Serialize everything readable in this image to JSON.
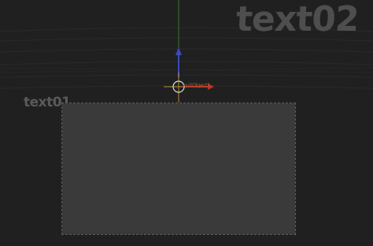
{
  "scene": {
    "big_text_object": "text02",
    "small_text_object": "text01",
    "gizmo_label": "nullObject1"
  },
  "colors": {
    "background": "#202020",
    "plane_fill": "#3a3a3a",
    "x_axis": "#c0302a",
    "y_axis": "#3a4ab8",
    "z_axis": "#2e7a2e",
    "gizmo_crosshair": "#c08a30"
  },
  "icons": {
    "pivot": "circle-crosshair-icon",
    "y_arrow": "arrow-up-icon",
    "x_arrow": "arrow-right-icon"
  }
}
